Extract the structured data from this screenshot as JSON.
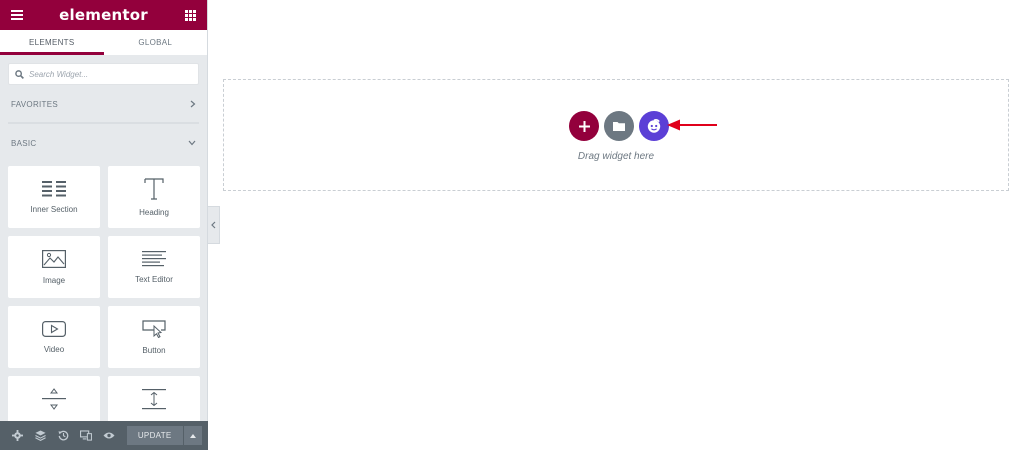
{
  "app": {
    "logo": "elementor"
  },
  "tabs": [
    {
      "label": "ELEMENTS",
      "active": true
    },
    {
      "label": "GLOBAL",
      "active": false
    }
  ],
  "search": {
    "placeholder": "Search Widget..."
  },
  "categories": {
    "favorites": "FAVORITES",
    "basic": "BASIC"
  },
  "widgets": [
    {
      "label": "Inner Section",
      "icon": "inner-section-icon"
    },
    {
      "label": "Heading",
      "icon": "heading-icon"
    },
    {
      "label": "Image",
      "icon": "image-icon"
    },
    {
      "label": "Text Editor",
      "icon": "text-editor-icon"
    },
    {
      "label": "Video",
      "icon": "video-icon"
    },
    {
      "label": "Button",
      "icon": "button-icon"
    },
    {
      "label": "",
      "icon": "divider-icon"
    },
    {
      "label": "",
      "icon": "spacer-icon"
    }
  ],
  "footer": {
    "update_label": "UPDATE"
  },
  "canvas": {
    "drag_text": "Drag widget here"
  },
  "colors": {
    "brand": "#93003c",
    "template_button": "#6d7882",
    "ai_button": "#5b3fd6",
    "arrow": "#e0001b"
  }
}
